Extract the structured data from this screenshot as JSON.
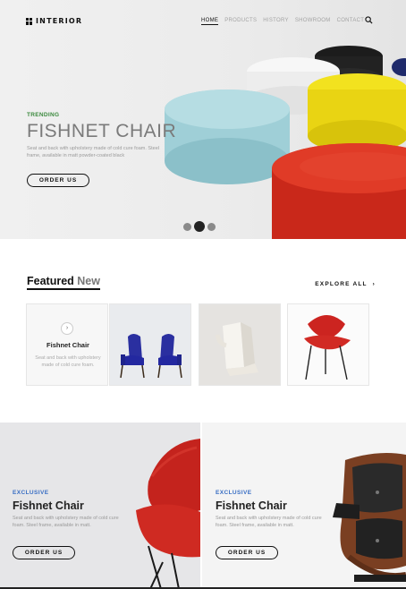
{
  "nav": {
    "logo_text": "INTERIOR",
    "items": [
      {
        "label": "HOME",
        "active": true
      },
      {
        "label": "PRODUCTS"
      },
      {
        "label": "HISTORY"
      },
      {
        "label": "SHOWROOM"
      },
      {
        "label": "CONTACT"
      }
    ],
    "search_icon": "search-icon"
  },
  "hero": {
    "tag": "TRENDING",
    "title": "FISHNET CHAIR",
    "description": "Seat and back with upholstery made of cold cure foam. Steel frame, available in matt powder-coated black",
    "button": "ORDER US",
    "slider_active_index": 1,
    "slider_count": 3
  },
  "featured": {
    "title_part1": "Featured",
    "title_part2": "New",
    "explore": "EXPLORE ALL",
    "card1": {
      "title": "Fishnet Chair",
      "description": "Seat and back with upholstery made of cold cure foam."
    }
  },
  "promos": [
    {
      "tag": "EXCLUSIVE",
      "title": "Fishnet Chair",
      "description": "Seat and back with upholstery made of cold cure foam. Steel frame, available in matt.",
      "button": "ORDER US"
    },
    {
      "tag": "EXCLUSIVE",
      "title": "Fishnet Chair",
      "description": "Seat and back with upholstery made of cold cure foam. Steel frame, available in matt.",
      "button": "ORDER US"
    }
  ],
  "colors": {
    "accent_green": "#3c8a3f",
    "accent_blue": "#3a6fc4",
    "chair_red": "#c8241c",
    "chair_blue": "#2a2f9c"
  }
}
